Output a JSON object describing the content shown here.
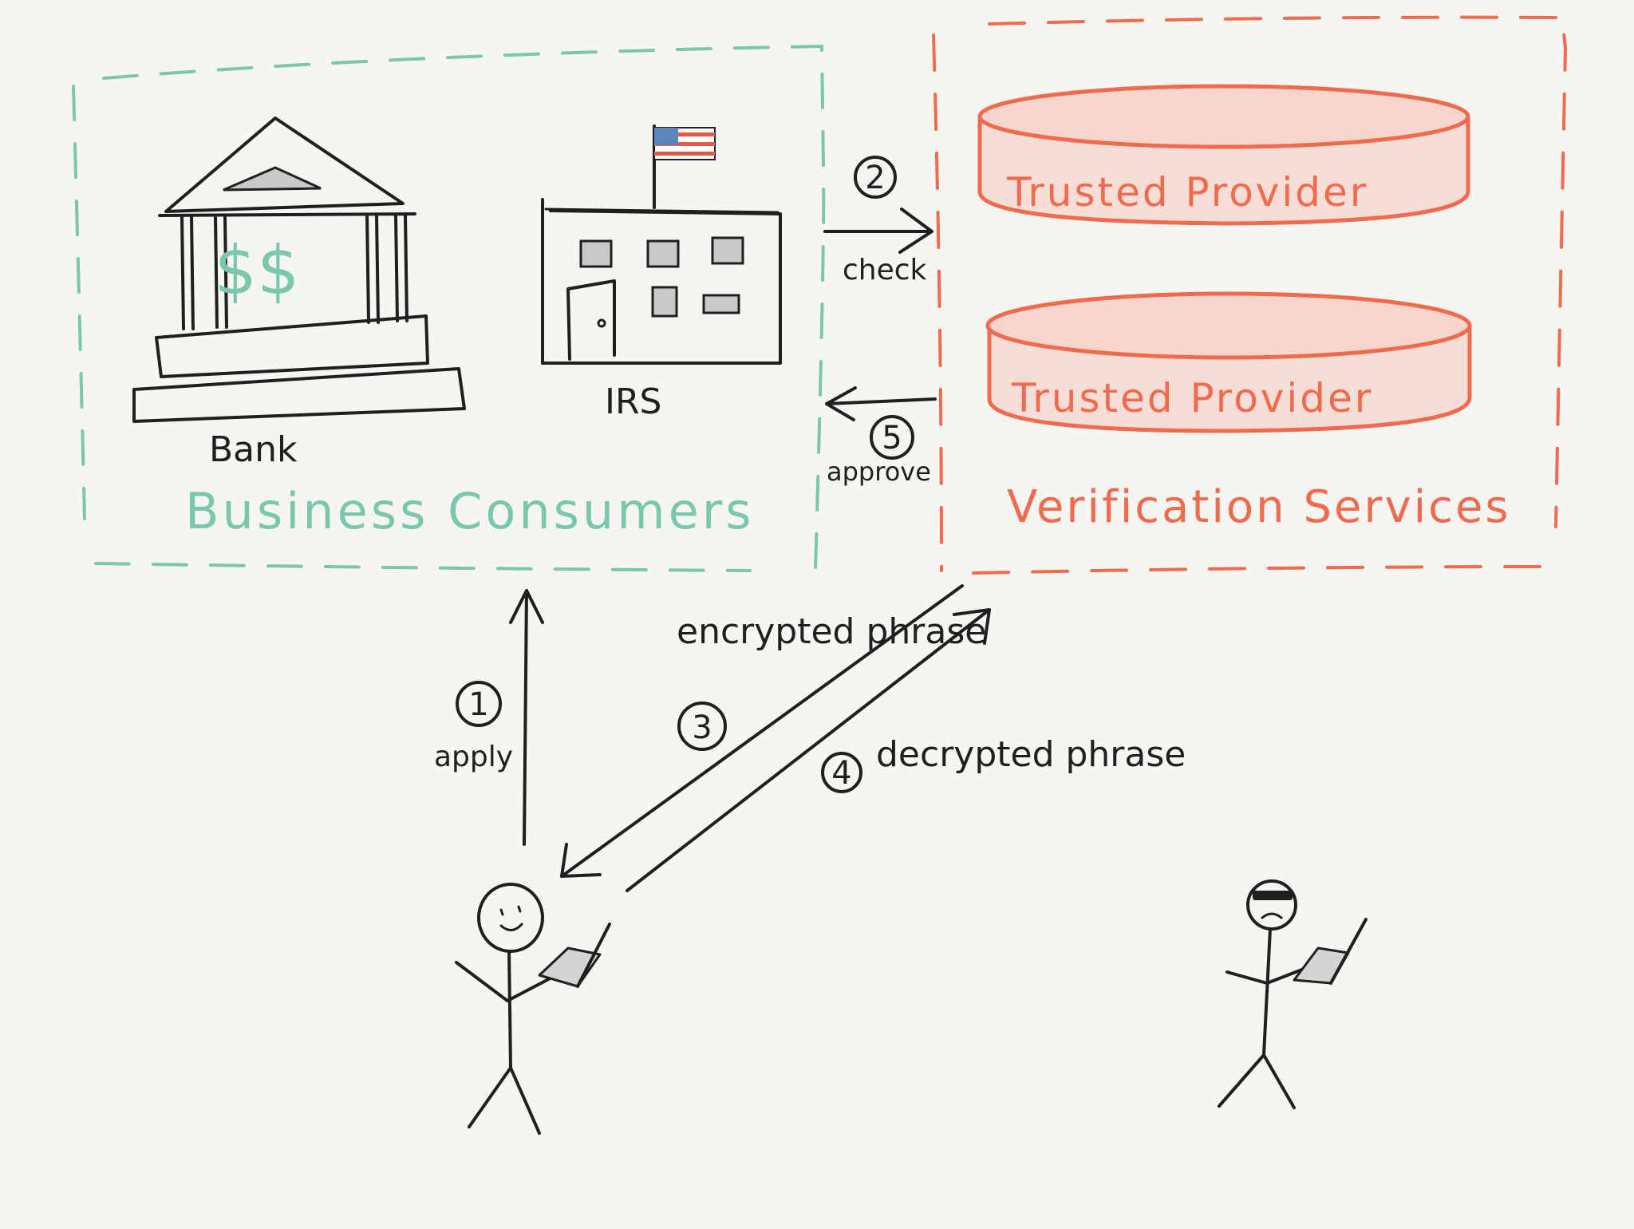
{
  "colors": {
    "background": "#f6f5f1",
    "business_group": "#79c7ad",
    "verification_group": "#f06a4e",
    "provider_fill": "#f6ddd6",
    "ink": "#1f1f1f",
    "flag_blue": "#5a87b8",
    "flag_red": "#e25a4a"
  },
  "business_consumers": {
    "title": "Business Consumers",
    "bank": {
      "label": "Bank",
      "sign": "$$",
      "icon": "bank-icon"
    },
    "irs": {
      "label": "IRS",
      "icon": "government-building-icon"
    }
  },
  "verification_services": {
    "title": "Verification Services",
    "providers": [
      {
        "label": "Trusted Provider",
        "icon": "database-icon"
      },
      {
        "label": "Trusted Provider",
        "icon": "database-icon"
      }
    ]
  },
  "steps": [
    {
      "number": "1",
      "label": "apply"
    },
    {
      "number": "2",
      "label": "check"
    },
    {
      "number": "3",
      "label": "encrypted phrase"
    },
    {
      "number": "4",
      "label": "decrypted phrase"
    },
    {
      "number": "5",
      "label": "approve"
    }
  ],
  "actors": {
    "user": {
      "icon": "happy-stick-figure-icon",
      "device": "laptop-icon"
    },
    "attacker": {
      "icon": "masked-stick-figure-icon",
      "device": "laptop-icon"
    }
  }
}
